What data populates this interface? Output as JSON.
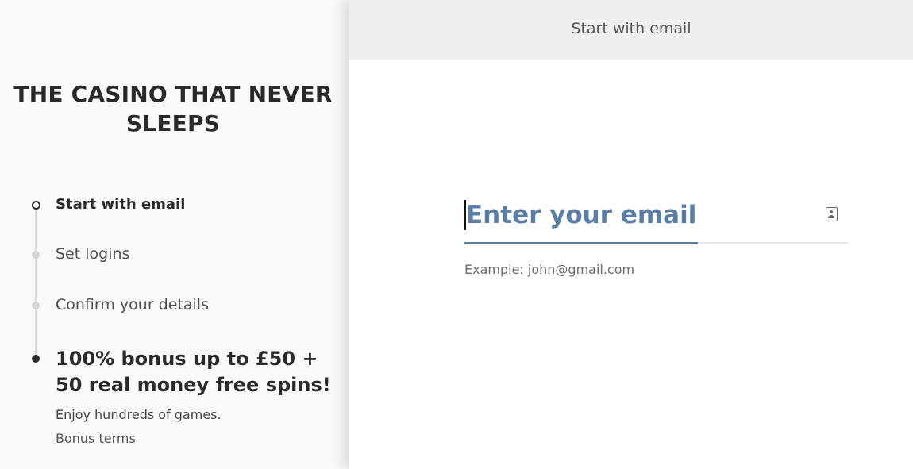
{
  "sidebar": {
    "title": "THE CASINO THAT NEVER SLEEPS",
    "steps": [
      {
        "label": "Start with email",
        "state": "current"
      },
      {
        "label": "Set logins",
        "state": "pending"
      },
      {
        "label": "Confirm your details",
        "state": "pending"
      }
    ],
    "bonus": {
      "headline": "100% bonus up to £50 + 50 real money free spins!",
      "subtitle": "Enjoy hundreds of games.",
      "terms_link": "Bonus terms"
    }
  },
  "main": {
    "header_title": "Start with email",
    "email_field": {
      "placeholder": "Enter your email",
      "value": "",
      "hint": "Example: john@gmail.com",
      "icon": "contact-card-icon"
    }
  },
  "colors": {
    "accent": "#5a7ea6",
    "text_dark": "#2a2a2a",
    "sidebar_bg": "#f9f9f9",
    "header_bg": "#efefef"
  }
}
